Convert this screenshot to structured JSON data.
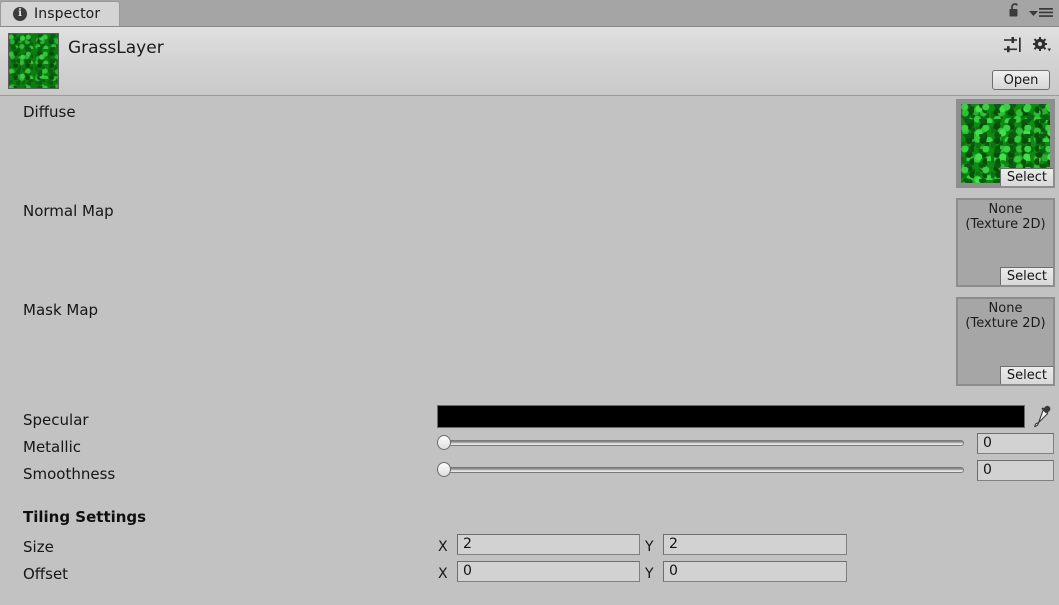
{
  "window": {
    "tab_label": "Inspector",
    "tab_icon": "info-icon",
    "lock_icon": "lock-open-icon",
    "menu_icon": "hamburger-menu-icon"
  },
  "header": {
    "title": "GrassLayer",
    "thumbnail_icon": "grass-texture-thumbnail",
    "preset_icon": "preset-sliders-icon",
    "settings_icon": "gear-icon",
    "open_label": "Open"
  },
  "properties": {
    "diffuse": {
      "label": "Diffuse",
      "value": "",
      "select_label": "Select",
      "has_texture": true
    },
    "normal_map": {
      "label": "Normal Map",
      "value_line1": "None",
      "value_line2": "(Texture 2D)",
      "select_label": "Select",
      "has_texture": false
    },
    "mask_map": {
      "label": "Mask Map",
      "value_line1": "None",
      "value_line2": "(Texture 2D)",
      "select_label": "Select",
      "has_texture": false
    },
    "specular": {
      "label": "Specular",
      "color": "#000000",
      "eyedropper_icon": "eyedropper-icon"
    },
    "metallic": {
      "label": "Metallic",
      "value": "0",
      "min": 0,
      "max": 1,
      "percent": 0
    },
    "smoothness": {
      "label": "Smoothness",
      "value": "0",
      "min": 0,
      "max": 1,
      "percent": 0
    }
  },
  "tiling": {
    "section_label": "Tiling Settings",
    "size": {
      "label": "Size",
      "x_label": "X",
      "x_value": "2",
      "y_label": "Y",
      "y_value": "2"
    },
    "offset": {
      "label": "Offset",
      "x_label": "X",
      "x_value": "0",
      "y_label": "Y",
      "y_value": "0"
    }
  }
}
